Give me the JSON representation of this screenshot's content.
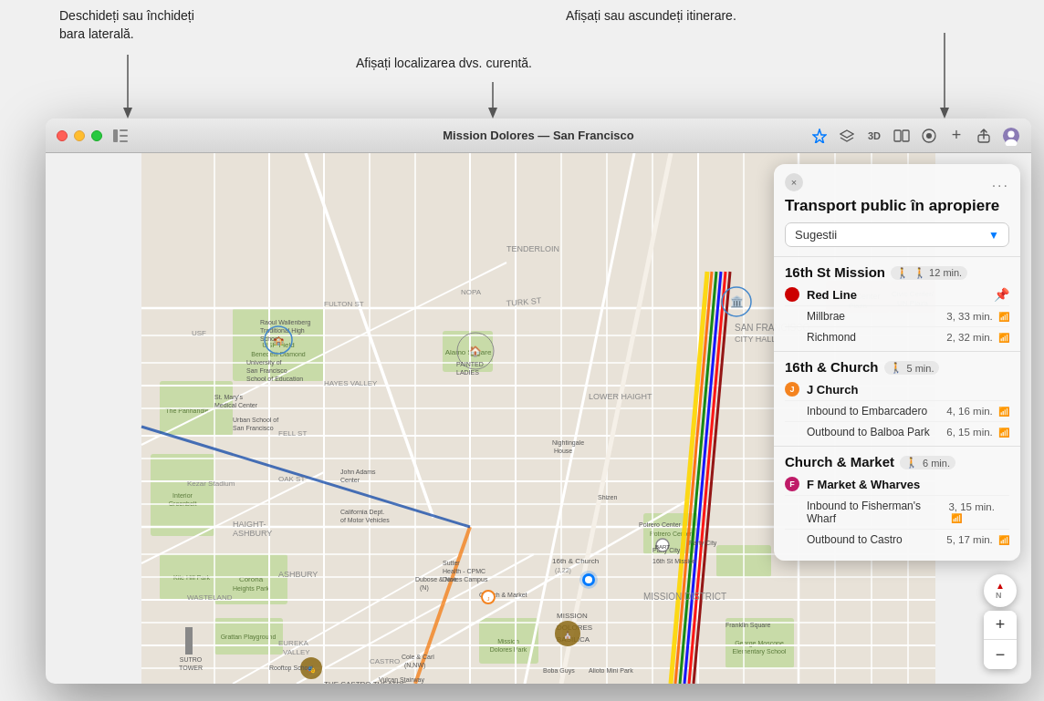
{
  "annotations": {
    "left_text_line1": "Deschideți sau închideți",
    "left_text_line2": "bara laterală.",
    "center_text": "Afișați localizarea dvs. curentă.",
    "right_text": "Afișați sau ascundeți itinerare."
  },
  "window": {
    "title": "Mission Dolores — San Francisco",
    "sidebar_icon_label": "sidebar"
  },
  "toolbar": {
    "icons": [
      "location",
      "overlay",
      "3d",
      "map-type",
      "favorite",
      "plus",
      "share",
      "profile"
    ]
  },
  "panel": {
    "title": "Transport public în apropiere",
    "close_label": "×",
    "more_label": "...",
    "dropdown_value": "Sugestii",
    "sections": [
      {
        "station": "16th St Mission",
        "walk": "🚶 12 min.",
        "lines": [
          {
            "color": "#CC0000",
            "label": "",
            "name": "Red Line",
            "pinned": true,
            "routes": [
              {
                "destination": "Millbrae",
                "time": "3, 33 min."
              },
              {
                "destination": "Richmond",
                "time": "2, 32 min."
              }
            ]
          }
        ]
      },
      {
        "station": "16th & Church",
        "walk": "🚶 5 min.",
        "lines": [
          {
            "color": "#F4831F",
            "label": "J",
            "name": "J Church",
            "pinned": false,
            "routes": [
              {
                "destination": "Inbound to Embarcadero",
                "time": "4, 16 min."
              },
              {
                "destination": "Outbound to Balboa Park",
                "time": "6, 15 min."
              }
            ]
          }
        ]
      },
      {
        "station": "Church & Market",
        "walk": "🚶 6 min.",
        "lines": [
          {
            "color": "#BF1B68",
            "label": "F",
            "name": "F Market & Wharves",
            "pinned": false,
            "routes": [
              {
                "destination": "Inbound to Fisherman's Wharf",
                "time": "3, 15 min."
              },
              {
                "destination": "Outbound to Castro",
                "time": "5, 17 min."
              }
            ]
          }
        ]
      }
    ]
  },
  "map": {
    "zoom_plus": "+",
    "zoom_minus": "−",
    "compass": "N"
  }
}
